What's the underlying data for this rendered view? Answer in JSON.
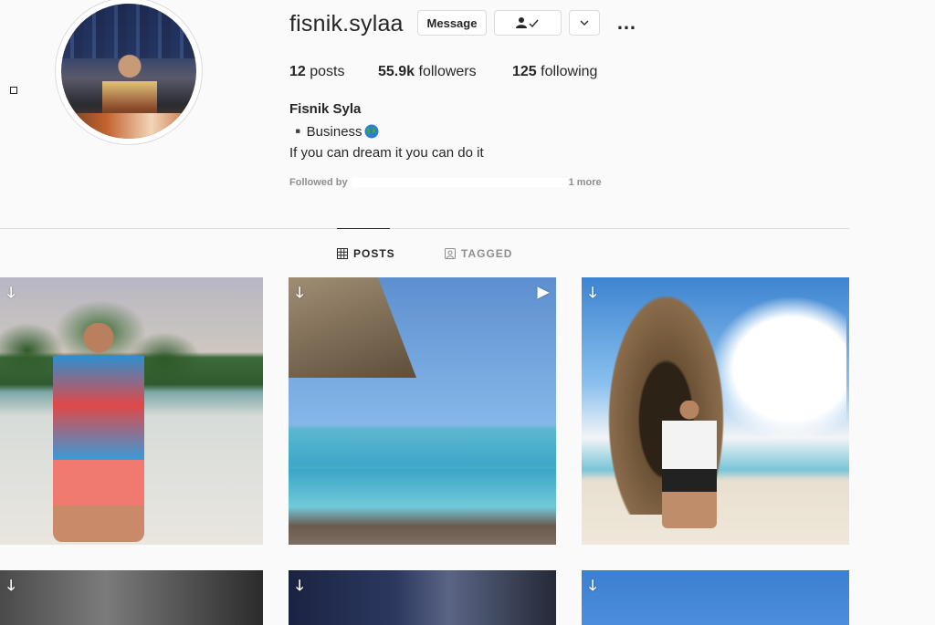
{
  "profile": {
    "username": "fisnik.sylaa",
    "full_name": "Fisnik Syla",
    "bio_line1": "▪️Business",
    "bio_line1_icon": "globe-icon",
    "bio_line2": "If you can dream it you can do it",
    "followed_by_label": "Followed by",
    "followed_by_more": "1 more"
  },
  "actions": {
    "message_label": "Message",
    "following_icon": "person-check-icon",
    "more_icon": "chevron-down-icon",
    "options_icon": "…"
  },
  "stats": {
    "posts_count": "12",
    "posts_label": "posts",
    "followers_count": "55.9k",
    "followers_label": "followers",
    "following_count": "125",
    "following_label": "following"
  },
  "tabs": [
    {
      "label": "POSTS",
      "icon": "grid-icon",
      "active": true
    },
    {
      "label": "TAGGED",
      "icon": "tag-icon",
      "active": false
    }
  ],
  "posts": [
    {
      "overlay_icon": "download-arrow-icon",
      "type_icon": ""
    },
    {
      "overlay_icon": "download-arrow-icon",
      "type_icon": "play-icon"
    },
    {
      "overlay_icon": "download-arrow-icon",
      "type_icon": ""
    },
    {
      "overlay_icon": "download-arrow-icon",
      "type_icon": ""
    },
    {
      "overlay_icon": "download-arrow-icon",
      "type_icon": ""
    },
    {
      "overlay_icon": "download-arrow-icon",
      "type_icon": ""
    }
  ],
  "colors": {
    "background": "#fafafa",
    "text": "#262626",
    "muted": "#8e8e8e",
    "border": "#dbdbdb"
  }
}
